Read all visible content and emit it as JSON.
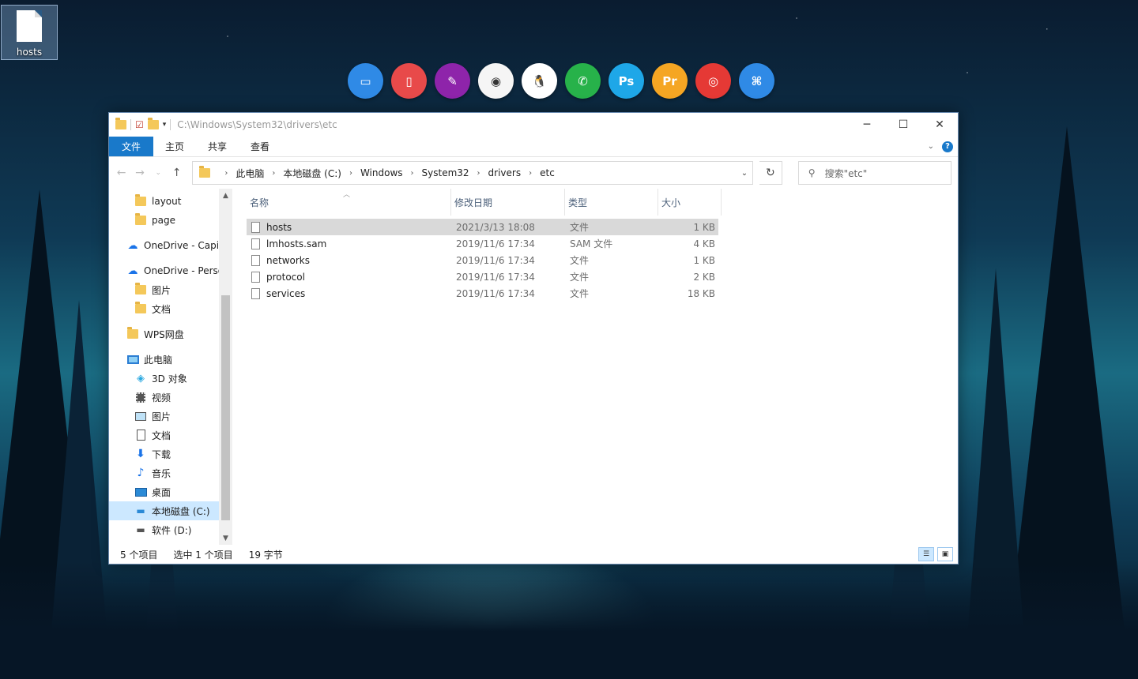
{
  "desktop": {
    "icon_label": "hosts"
  },
  "dock": [
    {
      "name": "monitor-app-icon",
      "color": "#2f8ae6",
      "glyph": "▭"
    },
    {
      "name": "cup-app-icon",
      "color": "#e84a4a",
      "glyph": "▯"
    },
    {
      "name": "notes-app-icon",
      "color": "#8e24aa",
      "glyph": "✎"
    },
    {
      "name": "chrome-icon",
      "color": "#f5f5f5",
      "glyph": "◉"
    },
    {
      "name": "qq-icon",
      "color": "#ffffff",
      "glyph": "🐧"
    },
    {
      "name": "wechat-icon",
      "color": "#27b24a",
      "glyph": "✆"
    },
    {
      "name": "photoshop-icon",
      "color": "#1ea7e8",
      "glyph": "Ps"
    },
    {
      "name": "premiere-icon",
      "color": "#f5a623",
      "glyph": "Pr"
    },
    {
      "name": "netease-music-icon",
      "color": "#e53935",
      "glyph": "◎"
    },
    {
      "name": "python-icon",
      "color": "#2f8ae6",
      "glyph": "⌘"
    }
  ],
  "window": {
    "title": "C:\\Windows\\System32\\drivers\\etc",
    "tabs": {
      "file": "文件",
      "home": "主页",
      "share": "共享",
      "view": "查看"
    },
    "breadcrumb": [
      "此电脑",
      "本地磁盘 (C:)",
      "Windows",
      "System32",
      "drivers",
      "etc"
    ],
    "search_placeholder": "搜索\"etc\""
  },
  "sidebar": {
    "items": [
      {
        "label": "layout"
      },
      {
        "label": "page"
      },
      {
        "label": "OneDrive - Capi"
      },
      {
        "label": "OneDrive - Perso"
      },
      {
        "label": "图片"
      },
      {
        "label": "文档"
      },
      {
        "label": "WPS网盘"
      },
      {
        "label": "此电脑"
      },
      {
        "label": "3D 对象"
      },
      {
        "label": "视频"
      },
      {
        "label": "图片"
      },
      {
        "label": "文档"
      },
      {
        "label": "下载"
      },
      {
        "label": "音乐"
      },
      {
        "label": "桌面"
      },
      {
        "label": "本地磁盘 (C:)"
      },
      {
        "label": "软件 (D:)"
      }
    ]
  },
  "columns": {
    "name": "名称",
    "date": "修改日期",
    "type": "类型",
    "size": "大小"
  },
  "files": [
    {
      "name": "hosts",
      "date": "2021/3/13 18:08",
      "type": "文件",
      "size": "1 KB"
    },
    {
      "name": "lmhosts.sam",
      "date": "2019/11/6 17:34",
      "type": "SAM 文件",
      "size": "4 KB"
    },
    {
      "name": "networks",
      "date": "2019/11/6 17:34",
      "type": "文件",
      "size": "1 KB"
    },
    {
      "name": "protocol",
      "date": "2019/11/6 17:34",
      "type": "文件",
      "size": "2 KB"
    },
    {
      "name": "services",
      "date": "2019/11/6 17:34",
      "type": "文件",
      "size": "18 KB"
    }
  ],
  "status": {
    "count": "5 个项目",
    "selected": "选中 1 个项目",
    "bytes": "19 字节"
  }
}
